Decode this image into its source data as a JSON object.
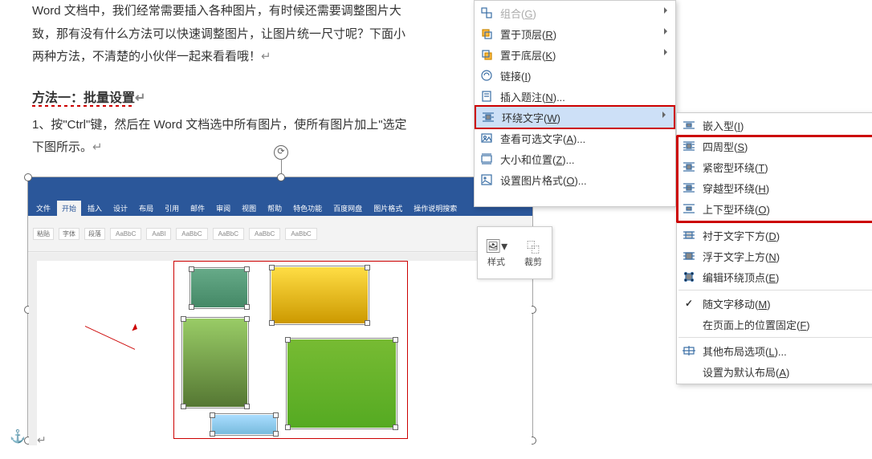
{
  "doc": {
    "p1a": "Word 文档中，我们经常需要插入各种图片，有时候还需要调整图片大",
    "p1b": "致，那有没有什么方法可以快速调整图片，让图片统一尺寸呢？下面小",
    "p1c": "两种方法，不清楚的小伙伴一起来看看哦！",
    "h1": "方法一：批量设置",
    "p2a": "1、按\"Ctrl\"键，然后在 Word 文档选中所有图片，使所有图片加上\"选定",
    "p2b": "下图所示。"
  },
  "ribbon": {
    "tabs": [
      "文件",
      "开始",
      "插入",
      "设计",
      "布局",
      "引用",
      "邮件",
      "审阅",
      "视图",
      "帮助",
      "特色功能",
      "百度网盘",
      "图片格式"
    ],
    "tell": "操作说明搜索",
    "styles": [
      "AaBbC",
      "AaBl",
      "AaBbC",
      "AaBbC",
      "AaBbC",
      "AaBbC"
    ]
  },
  "menu1": {
    "items": [
      {
        "icon": "group",
        "label": "组合(",
        "u": "G",
        "rest": ")",
        "sub": true,
        "disabled": true
      },
      {
        "icon": "front",
        "label": "置于顶层(",
        "u": "R",
        "rest": ")",
        "sub": true
      },
      {
        "icon": "back",
        "label": "置于底层(",
        "u": "K",
        "rest": ")",
        "sub": true
      },
      {
        "icon": "link",
        "label": "链接(",
        "u": "I",
        "rest": ")"
      },
      {
        "icon": "caption",
        "label": "插入题注(",
        "u": "N",
        "rest": ")..."
      },
      {
        "icon": "wrap",
        "label": "环绕文字(",
        "u": "W",
        "rest": ")",
        "sub": true,
        "hl": true
      },
      {
        "icon": "alt",
        "label": "查看可选文字(",
        "u": "A",
        "rest": ")..."
      },
      {
        "icon": "size",
        "label": "大小和位置(",
        "u": "Z",
        "rest": ")..."
      },
      {
        "icon": "format",
        "label": "设置图片格式(",
        "u": "O",
        "rest": ")..."
      }
    ]
  },
  "menu2": {
    "items": [
      {
        "icon": "w-inline",
        "label": "嵌入型(",
        "u": "I",
        "rest": ")"
      },
      {
        "icon": "w-square",
        "label": "四周型(",
        "u": "S",
        "rest": ")",
        "boxed": true
      },
      {
        "icon": "w-tight",
        "label": "紧密型环绕(",
        "u": "T",
        "rest": ")",
        "boxed": true
      },
      {
        "icon": "w-through",
        "label": "穿越型环绕(",
        "u": "H",
        "rest": ")",
        "boxed": true
      },
      {
        "icon": "w-topbot",
        "label": "上下型环绕(",
        "u": "O",
        "rest": ")",
        "boxed": true
      },
      {
        "sep": true
      },
      {
        "icon": "w-behind",
        "label": "衬于文字下方(",
        "u": "D",
        "rest": ")"
      },
      {
        "icon": "w-front",
        "label": "浮于文字上方(",
        "u": "N",
        "rest": ")"
      },
      {
        "icon": "w-edit",
        "label": "编辑环绕顶点(",
        "u": "E",
        "rest": ")"
      },
      {
        "sep": true
      },
      {
        "icon": "check",
        "label": "随文字移动(",
        "u": "M",
        "rest": ")",
        "checked": true
      },
      {
        "icon": "",
        "label": "在页面上的位置固定(",
        "u": "F",
        "rest": ")"
      },
      {
        "sep": true
      },
      {
        "icon": "w-more",
        "label": "其他布局选项(",
        "u": "L",
        "rest": ")..."
      },
      {
        "icon": "",
        "label": "设置为默认布局(",
        "u": "A",
        "rest": ")"
      }
    ]
  },
  "float": {
    "style": "样式",
    "crop": "裁剪"
  }
}
